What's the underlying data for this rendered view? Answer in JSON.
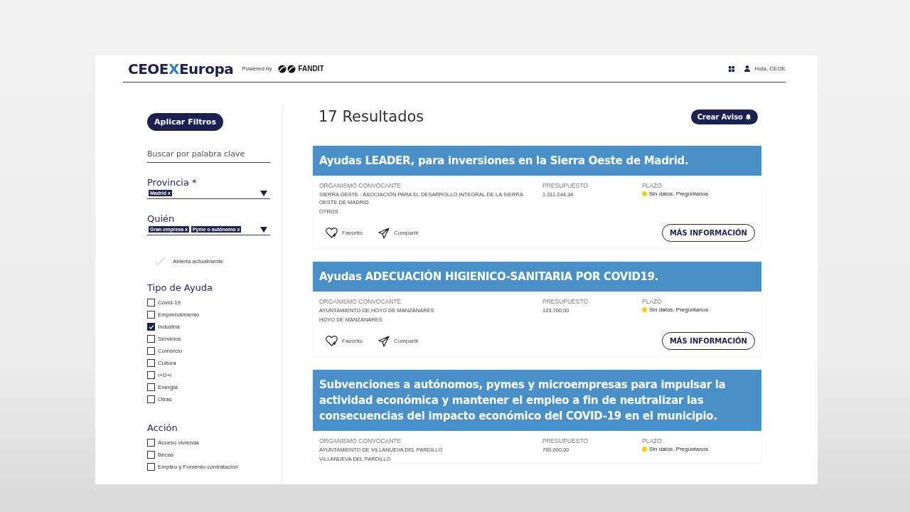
{
  "header": {
    "logo": {
      "part_1": "CEOE",
      "part_2": "X",
      "part_3": "Europa"
    },
    "powered_by": "Powered by",
    "partner": "FANDIT",
    "user": "Hola, CEOE"
  },
  "filters": {
    "apply_button": "Aplicar Filtros",
    "search": {
      "placeholder": "Buscar por palabra clave"
    },
    "selects": [
      {
        "label": "Provincia *",
        "tags": [
          "Madrid x"
        ]
      },
      {
        "label": "Quién",
        "tags": [
          "Gran empresa x",
          "Pyme o autónomo x"
        ]
      }
    ],
    "open_now": {
      "label": "Abierta actualmente",
      "checked": false
    },
    "groups": [
      {
        "title": "Tipo de Ayuda",
        "items": [
          {
            "label": "Covid-19",
            "checked": false
          },
          {
            "label": "Emprendimiento",
            "checked": false
          },
          {
            "label": "Industria",
            "checked": true
          },
          {
            "label": "Servicios",
            "checked": false
          },
          {
            "label": "Comercio",
            "checked": false
          },
          {
            "label": "Cultura",
            "checked": false
          },
          {
            "label": "I+D+i",
            "checked": false
          },
          {
            "label": "Energía",
            "checked": false
          },
          {
            "label": "Otras",
            "checked": false
          }
        ]
      },
      {
        "title": "Acción",
        "items": [
          {
            "label": "Acceso vivienda",
            "checked": false
          },
          {
            "label": "Becas",
            "checked": false
          },
          {
            "label": "Empleo y Fomento contratación",
            "checked": false
          }
        ]
      }
    ]
  },
  "results": {
    "title": "17 Resultados",
    "alert_button": "Crear Aviso",
    "cards": [
      {
        "title": "Ayudas LEADER, para inversiones en la Sierra Oeste de Madrid.",
        "org_label": "ORGANISMO CONVOCANTE",
        "org_lines": [
          "SIERRA OESTE - ASOCIACIÓN PARA EL DESARROLLO INTEGRAL DE LA SIERRA OESTE DE MADRID",
          "OTROS"
        ],
        "budget_label": "PRESUPUESTO",
        "budget": "1.311.244,34",
        "deadline_label": "PLAZO",
        "deadline": "Sin datos. Pregúntanos",
        "color": "#f5d000",
        "favorite": "Favorito",
        "share": "Compartir",
        "more": "MÁS INFORMACIÓN"
      },
      {
        "title": "Ayudas ADECUACIÓN HIGIENICO-SANITARIA POR COVID19.",
        "org_label": "ORGANISMO CONVOCANTE",
        "org_lines": [
          "AYUNTAMIENTO DE HOYO DE MANZANARES",
          "HOYO DE MANZANARES"
        ],
        "budget_label": "PRESUPUESTO",
        "budget": "123.700,00",
        "deadline_label": "PLAZO",
        "deadline": "Sin datos. Pregúntanos",
        "color": "#f5d000",
        "favorite": "Favorito",
        "share": "Compartir",
        "more": "MÁS INFORMACIÓN"
      },
      {
        "title": "Subvenciones a autónomos, pymes y microempresas para impulsar la actividad económica y mantener el empleo a fin de neutralizar las consecuencias del impacto económico del COVID-19 en el municipio.",
        "org_label": "ORGANISMO CONVOCANTE",
        "org_lines": [
          "AYUNTAMIENTO DE VILLANUEVA DEL PARDILLO",
          "VILLANUEVA DEL PARDILLO"
        ],
        "budget_label": "PRESUPUESTO",
        "budget": "700.000,00",
        "deadline_label": "PLAZO",
        "deadline": "Sin datos. Pregúntanos",
        "color": "#f5d000"
      }
    ]
  }
}
